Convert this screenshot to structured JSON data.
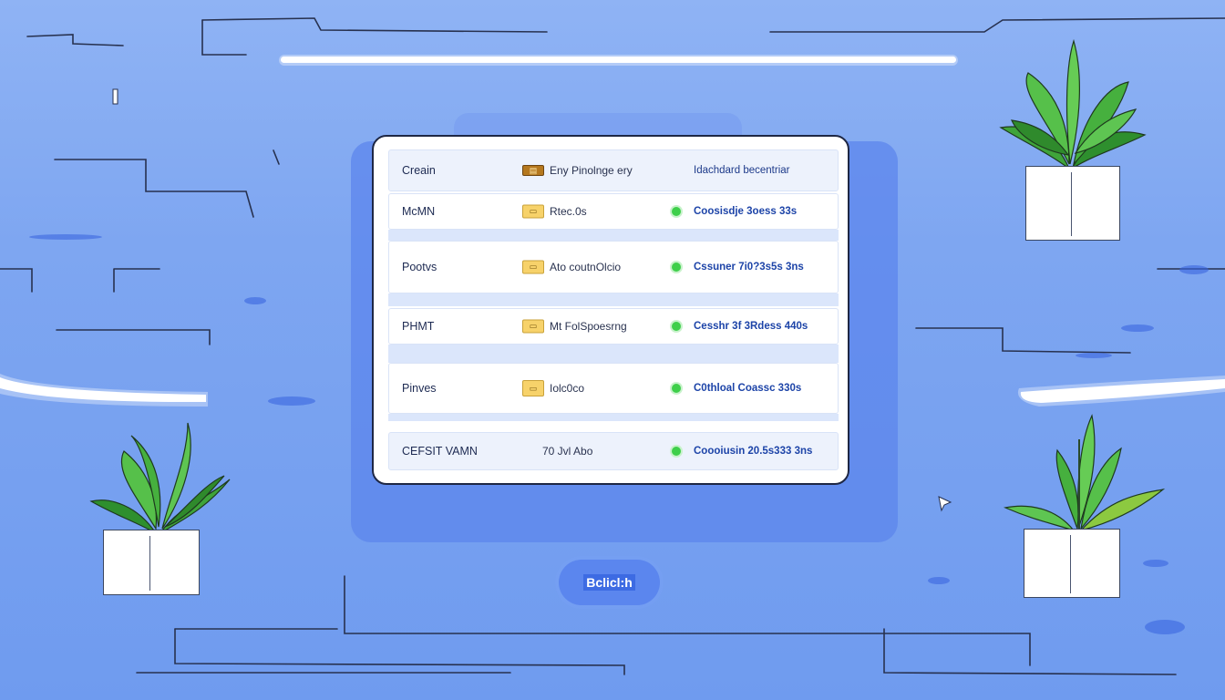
{
  "table": {
    "header": {
      "name": "Creain",
      "icon": "folder-icon",
      "detail": "Eny Pinolnge ery",
      "status": "Idachdard becentriar"
    },
    "rows": [
      {
        "name": "McMN",
        "icon": "folder-icon",
        "detail": "Rtec.0s",
        "status": "Coosisdje 3oess 33s"
      },
      {
        "name": "Pootvs",
        "icon": "folder-icon",
        "detail": "Ato coutnOlcio",
        "status": "Cssuner 7i0?3s5s 3ns"
      },
      {
        "name": "PHMT",
        "icon": "folder-icon",
        "detail": "Mt FolSpoesrng",
        "status": "Cesshr 3f 3Rdess 440s"
      },
      {
        "name": "Pinves",
        "icon": "folder-icon",
        "detail": "Iolc0co",
        "status": "C0thloal Coassc 330s"
      },
      {
        "name": "CEFSIT VAMN",
        "icon": "",
        "detail": "70 Jvl Abo",
        "status": "Coooiusin 20.5s333 3ns"
      }
    ]
  },
  "cta": {
    "label": "Bclicl:h"
  },
  "colors": {
    "background": "#7ea6f1",
    "accent": "#5b86ee",
    "status_dot": "#3ecf4a",
    "status_text": "#1d44a8"
  }
}
